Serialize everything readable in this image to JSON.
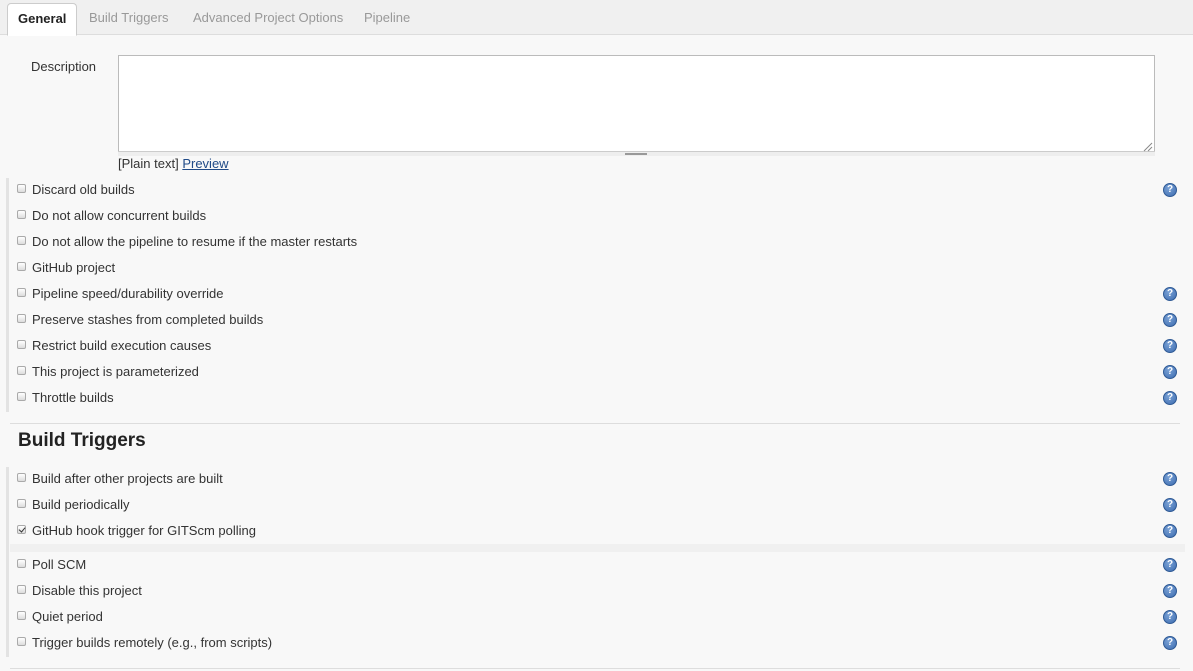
{
  "tabs": [
    "General",
    "Build Triggers",
    "Advanced Project Options",
    "Pipeline"
  ],
  "description": {
    "label": "Description",
    "value": "",
    "format_prefix": "[Plain text]",
    "preview_link": "Preview"
  },
  "general_options": [
    {
      "label": "Discard old builds",
      "checked": false,
      "help": true
    },
    {
      "label": "Do not allow concurrent builds",
      "checked": false,
      "help": false
    },
    {
      "label": "Do not allow the pipeline to resume if the master restarts",
      "checked": false,
      "help": false
    },
    {
      "label": "GitHub project",
      "checked": false,
      "help": false
    },
    {
      "label": "Pipeline speed/durability override",
      "checked": false,
      "help": true
    },
    {
      "label": "Preserve stashes from completed builds",
      "checked": false,
      "help": true
    },
    {
      "label": "Restrict build execution causes",
      "checked": false,
      "help": true
    },
    {
      "label": "This project is parameterized",
      "checked": false,
      "help": true
    },
    {
      "label": "Throttle builds",
      "checked": false,
      "help": true
    }
  ],
  "build_triggers": {
    "title": "Build Triggers",
    "options": [
      {
        "label": "Build after other projects are built",
        "checked": false,
        "help": true
      },
      {
        "label": "Build periodically",
        "checked": false,
        "help": true
      },
      {
        "label": "GitHub hook trigger for GITScm polling",
        "checked": true,
        "help": true
      },
      {
        "label": "Poll SCM",
        "checked": false,
        "help": true
      },
      {
        "label": "Disable this project",
        "checked": false,
        "help": true
      },
      {
        "label": "Quiet period",
        "checked": false,
        "help": true
      },
      {
        "label": "Trigger builds remotely (e.g., from scripts)",
        "checked": false,
        "help": true
      }
    ]
  },
  "help_icon_glyph": "?"
}
